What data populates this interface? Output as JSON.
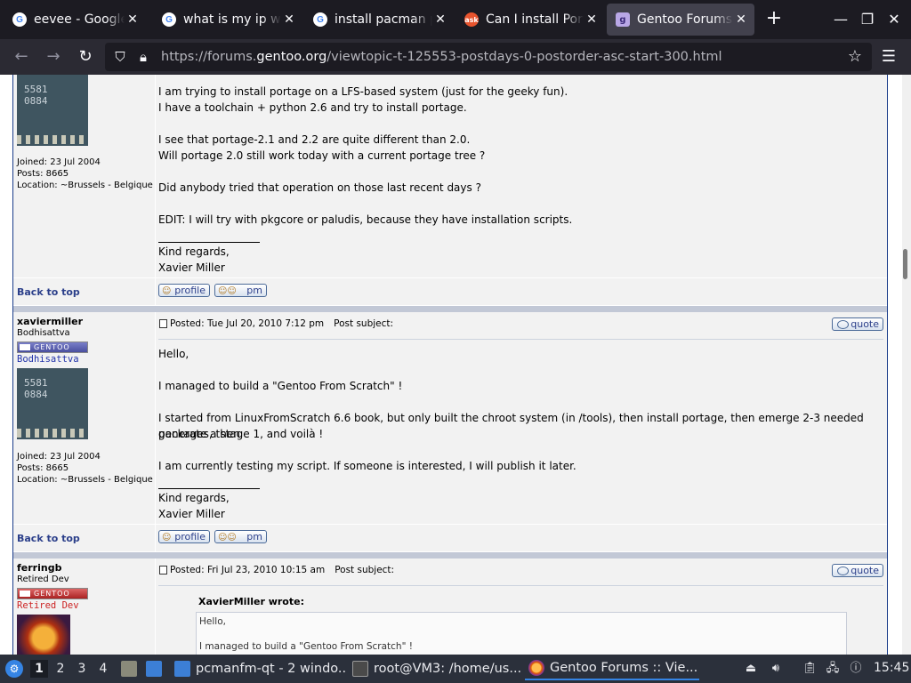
{
  "browser": {
    "tabs": [
      {
        "title": "eevee - Google S",
        "icon": "google-icon",
        "active": false
      },
      {
        "title": "what is my ip wh",
        "icon": "google-icon",
        "active": false
      },
      {
        "title": "install pacman p",
        "icon": "google-icon",
        "active": false
      },
      {
        "title": "Can I install Port",
        "icon": "ask-icon",
        "active": false
      },
      {
        "title": "Gentoo Forums :",
        "icon": "gentoo-icon",
        "active": true
      }
    ],
    "url_prefix": "https://forums.",
    "url_host": "gentoo.org",
    "url_path": "/viewtopic-t-125553-postdays-0-postorder-asc-start-300.html"
  },
  "post1": {
    "join": "Joined: 23 Jul 2004",
    "posts": "Posts: 8665",
    "location": "Location: ~Brussels - Belgique",
    "lines": [
      "I am trying to install portage on a LFS-based system (just for the geeky fun).",
      "I have a toolchain + python 2.6 and try to install portage.",
      "I see that portage-2.1 and 2.2 are quite different than 2.0.",
      "Will portage 2.0 still work today with a current portage tree ?",
      "Did anybody tried that operation on those last recent days ?",
      "EDIT: I will try with pkgcore or paludis, because they have installation scripts."
    ],
    "sig1": "Kind regards,",
    "sig2": "Xavier Miller",
    "back": "Back to top",
    "profile": "profile",
    "pm": "pm"
  },
  "post2": {
    "author": "xaviermiller",
    "rank": "Bodhisattva",
    "rank_badge": "GENTOO",
    "rank_label": "Bodhisattva",
    "avatar_text": "5581\n0884",
    "join": "Joined: 23 Jul 2004",
    "posts": "Posts: 8665",
    "location": "Location: ~Brussels - Belgique",
    "posted": "Posted: Tue Jul 20, 2010 7:12 pm",
    "subject": "Post subject:",
    "quote": "quote",
    "lines": [
      "Hello,",
      "I managed to build a \"Gentoo From Scratch\" !",
      "I started from LinuxFromScratch 6.6 book, but only built the chroot system (in /tools), then install portage, then emerge 2-3 needed packages, then",
      "generate a stage 1, and voilà !",
      "I am currently testing my script. If someone is interested, I will publish it later."
    ],
    "sig1": "Kind regards,",
    "sig2": "Xavier Miller",
    "back": "Back to top",
    "profile": "profile",
    "pm": "pm"
  },
  "post3": {
    "author": "ferringb",
    "rank": "Retired Dev",
    "rank_badge": "GENTOO",
    "rank_label": "Retired Dev",
    "posted": "Posted: Fri Jul 23, 2010 10:15 am",
    "subject": "Post subject:",
    "quote": "quote",
    "quote_author": "XavierMiller wrote:",
    "quote_lines": [
      "Hello,",
      "I managed to build a \"Gentoo From Scratch\" !"
    ]
  },
  "taskbar": {
    "desktops": [
      "1",
      "2",
      "3",
      "4"
    ],
    "tasks": [
      {
        "label": "pcmanfm-qt - 2 windo...",
        "icon": "folder-icon"
      },
      {
        "label": "root@VM3: /home/us...",
        "icon": "terminal-icon"
      },
      {
        "label": "Gentoo Forums :: Vie...",
        "icon": "firefox-icon"
      }
    ],
    "clock": "15:45"
  },
  "colors": {
    "tab_bar": "#1c1b22",
    "nav_bar": "#2b2a33",
    "forum_row": "#f2f2f2",
    "link": "#2b3f8a",
    "taskbar": "#2b303b"
  }
}
